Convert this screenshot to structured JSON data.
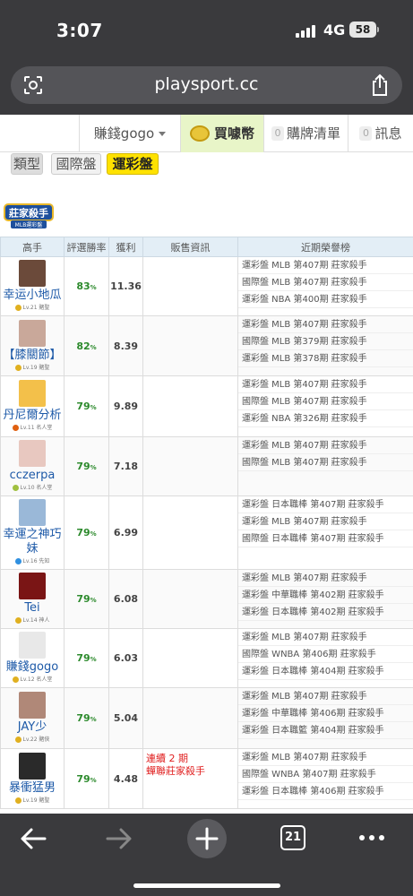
{
  "status_bar": {
    "time": "3:07",
    "network": "4G",
    "battery": "58"
  },
  "browser": {
    "url": "playsport.cc",
    "tabs_count": "21"
  },
  "nav": {
    "user": "賺錢gogo",
    "buy": "買噱幣",
    "cart_count": "0",
    "cart": "購牌清單",
    "msg_count": "0",
    "msg": "訊息"
  },
  "categories": {
    "type": "類型",
    "international": "國際盤",
    "lottery": "運彩盤"
  },
  "logo": {
    "line1": "莊家殺手",
    "line2": "MLB運彩盤"
  },
  "table": {
    "headers": {
      "player": "高手",
      "rate": "評選勝率",
      "profit": "獲利",
      "sale": "販售資訊",
      "honor": "近期榮譽榜"
    },
    "rows": [
      {
        "name": "幸运小地瓜",
        "level": "Lv.21 賭聖",
        "rate": "83",
        "profit": "11.36",
        "sale": [],
        "honors": [
          "運彩盤 MLB 第407期 莊家殺手",
          "國際盤 MLB 第407期 莊家殺手",
          "運彩盤 NBA 第400期 莊家殺手"
        ]
      },
      {
        "name": "【膝關節】",
        "level": "Lv.19 賭聖",
        "rate": "82",
        "profit": "8.39",
        "sale": [],
        "honors": [
          "運彩盤 MLB 第407期 莊家殺手",
          "國際盤 MLB 第379期 莊家殺手",
          "運彩盤 MLB 第378期 莊家殺手"
        ]
      },
      {
        "name": "丹尼爾分析",
        "level": "Lv.11 名人堂",
        "rate": "79",
        "profit": "9.89",
        "sale": [],
        "honors": [
          "運彩盤 MLB 第407期 莊家殺手",
          "國際盤 MLB 第407期 莊家殺手",
          "運彩盤 NBA 第326期 莊家殺手"
        ]
      },
      {
        "name": "cczerpa",
        "level": "Lv.10 名人堂",
        "rate": "79",
        "profit": "7.18",
        "sale": [],
        "honors": [
          "運彩盤 MLB 第407期 莊家殺手",
          "國際盤 MLB 第407期 莊家殺手"
        ]
      },
      {
        "name": "幸運之神巧妹",
        "level": "Lv.16 先知",
        "rate": "79",
        "profit": "6.99",
        "sale": [],
        "honors": [
          "運彩盤 日本職棒 第407期 莊家殺手",
          "運彩盤 MLB 第407期 莊家殺手",
          "國際盤 日本職棒 第407期 莊家殺手"
        ]
      },
      {
        "name": "Tei",
        "level": "Lv.14 神人",
        "rate": "79",
        "profit": "6.08",
        "sale": [],
        "honors": [
          "運彩盤 MLB 第407期 莊家殺手",
          "運彩盤 中華職棒 第402期 莊家殺手",
          "運彩盤 日本職棒 第402期 莊家殺手"
        ]
      },
      {
        "name": "賺錢gogo",
        "level": "Lv.12 名人堂",
        "rate": "79",
        "profit": "6.03",
        "sale": [],
        "honors": [
          "運彩盤 MLB 第407期 莊家殺手",
          "國際盤 WNBA 第406期 莊家殺手",
          "運彩盤 日本職棒 第404期 莊家殺手"
        ]
      },
      {
        "name": "JAY少",
        "level": "Lv.22 賭俠",
        "rate": "79",
        "profit": "5.04",
        "sale": [],
        "honors": [
          "運彩盤 MLB 第407期 莊家殺手",
          "運彩盤 中華職棒 第406期 莊家殺手",
          "運彩盤 日本職籃 第404期 莊家殺手"
        ]
      },
      {
        "name": "暴衝猛男",
        "level": "Lv.19 賭聖",
        "rate": "79",
        "profit": "4.48",
        "sale": [
          "連續 2 期",
          "蟬聯莊家殺手"
        ],
        "honors": [
          "運彩盤 MLB 第407期 莊家殺手",
          "國際盤 WNBA 第407期 莊家殺手",
          "運彩盤 日本職棒 第406期 莊家殺手"
        ]
      }
    ]
  }
}
